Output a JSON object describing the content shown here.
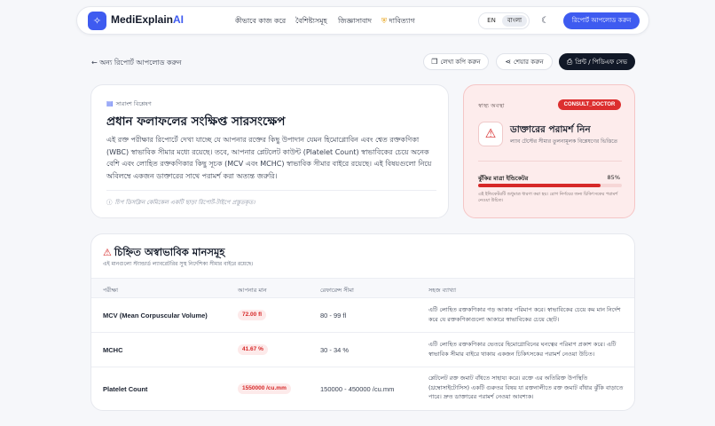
{
  "app": {
    "logo_main": "MediExplain",
    "logo_ai": "AI",
    "nav": [
      "কীভাবে কাজ করে",
      "বৈশিষ্ট্যসমূহ",
      "জিজ্ঞাসাবাদ",
      "দাবিত্যাগ"
    ],
    "lang_en": "EN",
    "lang_bn": "বাংলা",
    "upload_label": "রিপোর্ট আপলোড করুন",
    "accent": "#3e5bf0"
  },
  "actions": {
    "back": "অন্য রিপোর্ট আপলোড করুন",
    "copy": "লেখা কপি করুন",
    "share": "শেয়ার করুন",
    "print": "প্রিন্ট / পিডিএফ সেভ"
  },
  "summary": {
    "eyebrow": "সারাংশ বিশ্লেষণ",
    "title": "প্রধান ফলাফলের সংক্ষিপ্ত সারসংক্ষেপ",
    "body": "এই রক্ত পরীক্ষার রিপোর্টে দেখা যাচ্ছে যে আপনার রক্তের কিছু উপাদান যেমন হিমোগ্লোবিন এবং শ্বেত রক্তকণিকা (WBC) স্বাভাবিক সীমার মধ্যে রয়েছে। তবে, আপনার প্লেটলেট কাউন্ট (Platelet Count) স্বাভাবিকের চেয়ে অনেক বেশি এবং লোহিত রক্তকণিকার কিছু সূচক (MCV এবং MCHC) স্বাভাবিক সীমার বাইরে রয়েছে। এই বিষয়গুলো নিয়ে অবিলম্বে একজন ডাক্তারের সাথে পরামর্শ করা অত্যন্ত জরুরি।",
    "note": "চিপ ডিসক্লিন কেমিকেল একটি ছাড়া রিপোর্ট-টাইপে প্রস্তুতকৃত।"
  },
  "status": {
    "label": "স্বাস্থ্য অবস্থা",
    "badge": "CONSULT_DOCTOR",
    "title": "ডাক্তারের পরামর্শ নিন",
    "subtitle": "ল্যাব টেস্টের সীমার তুলনামূলক বিশ্লেষণের ভিত্তিতে",
    "risk_label": "ঝুঁকির মাত্রা ইন্ডিকেটর",
    "risk_pct_text": "85%",
    "risk_value": 0.85,
    "risk_note": "এই ইন্ডিকেটরটি শুধুমাত্র ধারণা করা হয়। রোগ নির্ণয়ের জন্য চিকিৎসকের পরামর্শ নেওয়া উচিত।",
    "danger": "#d62828"
  },
  "abnormal": {
    "title": "চিহ্নিত অস্বাভাবিক মানসমূহ",
    "subtitle": "এই মানগুলো স্ট্যান্ডার্ড ল্যাবরেটরির সুস্থ নির্দেশিকা সীমার বাইরে রয়েছে।",
    "headers": [
      "পরীক্ষা",
      "আপনার মান",
      "রেফারেন্স সীমা",
      "সহজ ব্যাখ্যা"
    ],
    "rows": [
      {
        "name": "MCV (Mean Corpuscular Volume)",
        "value": "72.00 fl",
        "ref": "80 - 99 fl",
        "explain": "এটি লোহিত রক্তকণিকার গড় আকার পরিমাপ করে। স্বাভাবিকের চেয়ে কম মান নির্দেশ করে যে রক্তকণিকাগুলো আকারে স্বাভাবিকের চেয়ে ছোট।"
      },
      {
        "name": "MCHC",
        "value": "41.67 %",
        "ref": "30 - 34 %",
        "explain": "এটি লোহিত রক্তকণিকার ভেতরে হিমোগ্লোবিনের ঘনত্বের পরিমাণ প্রকাশ করে। এটি স্বাভাবিক সীমার বাইরে থাকায় একজন চিকিৎসকের পরামর্শ নেওয়া উচিত।"
      },
      {
        "name": "Platelet Count",
        "value": "1550000 /cu.mm",
        "ref": "150000 - 450000 /cu.mm",
        "explain": "প্লেটলেট রক্ত জমাট বাঁধতে সাহায্য করে। রক্তে এর অতিরিক্ত উপস্থিতি (থ্রম্বোসাইটোসিস) একটি গুরুতর বিষয় যা রক্তনালীতে রক্ত জমাট বাঁধার ঝুঁকি বাড়াতে পারে। দ্রুত ডাক্তারের পরামর্শ নেওয়া আবশ্যক।"
      }
    ]
  }
}
